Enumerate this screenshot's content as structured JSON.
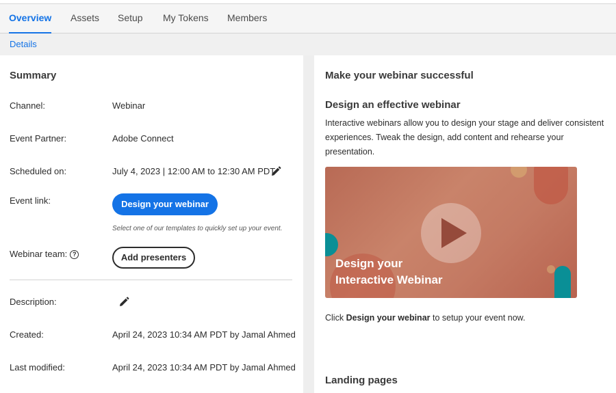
{
  "tabs": [
    {
      "label": "Overview",
      "active": true
    },
    {
      "label": "Assets",
      "active": false
    },
    {
      "label": "Setup",
      "active": false
    },
    {
      "label": "My Tokens",
      "active": false
    },
    {
      "label": "Members",
      "active": false
    }
  ],
  "subnav": {
    "details": "Details"
  },
  "summary": {
    "title": "Summary",
    "channel_label": "Channel:",
    "channel_value": "Webinar",
    "partner_label": "Event Partner:",
    "partner_value": "Adobe Connect",
    "scheduled_label": "Scheduled on:",
    "scheduled_value": "July 4, 2023 | 12:00 AM to 12:30 AM PDT",
    "event_link_label": "Event link:",
    "design_button": "Design your webinar",
    "design_hint": "Select one of our templates to quickly set up your event.",
    "team_label": "Webinar team:",
    "add_presenters_button": "Add presenters",
    "description_label": "Description:",
    "created_label": "Created:",
    "created_value": "April 24, 2023 10:34 AM PDT by Jamal Ahmed",
    "modified_label": "Last modified:",
    "modified_value": "April 24, 2023 10:34 AM PDT by Jamal Ahmed"
  },
  "success": {
    "title": "Make your webinar successful",
    "design_heading": "Design an effective webinar",
    "design_text": "Interactive webinars allow you to design your stage and deliver consistent experiences. Tweak the design, add content and rehearse your presentation.",
    "video_line1": "Design your",
    "video_line2": "Interactive Webinar",
    "cta_prefix": "Click ",
    "cta_bold": "Design your webinar",
    "cta_suffix": " to setup your event now.",
    "landing_heading": "Landing pages"
  },
  "colors": {
    "accent": "#1473e6",
    "video_bg": "#c47a63",
    "teal": "#0a8f96"
  },
  "icons": [
    "pencil-icon",
    "help-icon",
    "play-icon"
  ]
}
